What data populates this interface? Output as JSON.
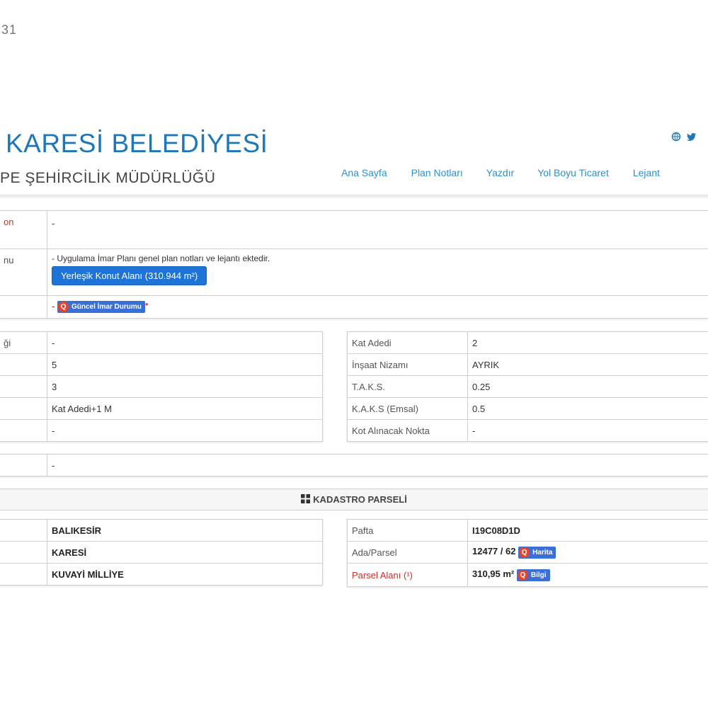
{
  "corner_text": "31",
  "header": {
    "title": "KARESİ BELEDİYESİ",
    "subtitle": "PE ŞEHİRCİLİK MÜDÜRLÜĞÜ",
    "social": [
      "globe-icon",
      "twitter-icon"
    ],
    "nav": [
      "Ana Sayfa",
      "Plan Notları",
      "Yazdır",
      "Yol Boyu Ticaret",
      "Lejant"
    ]
  },
  "top_table": {
    "row1": {
      "label": "on",
      "value": "-"
    },
    "row2": {
      "label": "nu",
      "note": "- Uygulama İmar Planı genel plan notları ve lejantı ektedir.",
      "button": "Yerleşik Konut Alanı (310.944 m²)"
    },
    "row3": {
      "label": "",
      "value_prefix": "-",
      "button": "Güncel İmar Durumu"
    }
  },
  "left_table": [
    {
      "label": "ği",
      "value": "-"
    },
    {
      "label": "",
      "value": "5"
    },
    {
      "label": "",
      "value": "3"
    },
    {
      "label": "",
      "value": "Kat Adedi+1 M"
    },
    {
      "label": "",
      "value": "-"
    }
  ],
  "right_table": [
    {
      "label": "Kat Adedi",
      "value": "2"
    },
    {
      "label": "İnşaat Nizamı",
      "value": "AYRIK"
    },
    {
      "label": "T.A.K.S.",
      "value": "0.25"
    },
    {
      "label": "K.A.K.S (Emsal)",
      "value": "0.5"
    },
    {
      "label": "Kot Alınacak Nokta",
      "value": "-"
    }
  ],
  "single_row": {
    "label": "",
    "value": "-"
  },
  "kadastro": {
    "title": "KADASTRO PARSELİ"
  },
  "parcel_left": [
    {
      "label": "",
      "value": "BALIKESİR"
    },
    {
      "label": "",
      "value": "KARESİ"
    },
    {
      "label": "",
      "value": "KUVAYİ MİLLİYE"
    }
  ],
  "parcel_right": {
    "pafta": {
      "label": "Pafta",
      "value": "I19C08D1D"
    },
    "ada": {
      "label": "Ada/Parsel",
      "value": "12477 / 62",
      "button": "Harita"
    },
    "alan": {
      "label": "Parsel Alanı (¹)",
      "value": "310,95 m²",
      "button": "Bilgi"
    }
  },
  "colors": {
    "brand": "#1d77b8",
    "nav": "#2b8fd0",
    "button": "#1e73d6",
    "accent_red": "#c9302c"
  }
}
